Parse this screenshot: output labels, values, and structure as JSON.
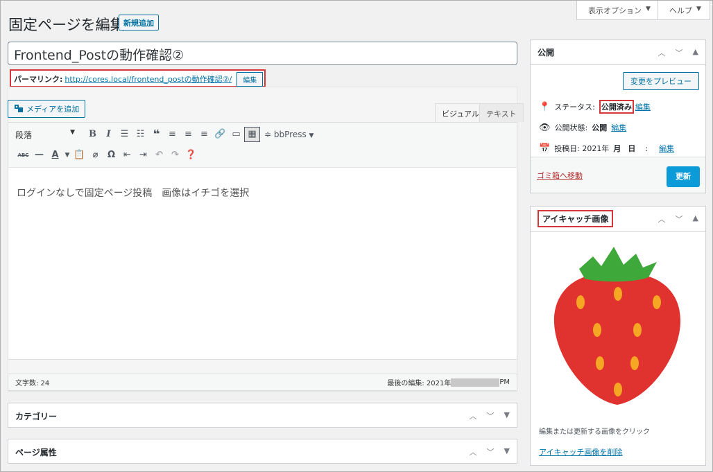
{
  "screen_tabs": {
    "options": "表示オプション",
    "help": "ヘルプ",
    "arrow": "▼"
  },
  "header": {
    "title": "固定ページを編集",
    "add_new": "新規追加"
  },
  "post": {
    "title": "Frontend_Postの動作確認②",
    "permalink_label": "パーマリンク:",
    "permalink_url": "http://cores.local/frontend_postの動作確認②/",
    "permalink_edit": "編集"
  },
  "editor": {
    "media_button": "メディアを追加",
    "tab_visual": "ビジュアル",
    "tab_text": "テキスト",
    "format_select": "段落",
    "bbpress": "bbPress",
    "content": "ログインなしで固定ページ投稿　画像はイチゴを選択",
    "word_count": "文字数: 24",
    "last_edit_prefix": "最後の編集: 2021年",
    "last_edit_suffix": "PM"
  },
  "boxes": {
    "category": "カテゴリー",
    "page_attributes": "ページ属性"
  },
  "publish": {
    "title": "公開",
    "preview": "変更をプレビュー",
    "status_label": "ステータス:",
    "status_value": "公開済み",
    "visibility_label": "公開状態:",
    "visibility_value": "公開",
    "date_label": "投稿日: 2021年",
    "date_month": "月",
    "date_day": "日",
    "date_colon": ":",
    "edit": "編集",
    "trash": "ゴミ箱へ移動",
    "update": "更新"
  },
  "thumbnail": {
    "title": "アイキャッチ画像",
    "hint": "編集または更新する画像をクリック",
    "remove": "アイキャッチ画像を削除"
  },
  "colors": {
    "accent": "#0073aa",
    "highlight": "#d63638",
    "update": "#0a9bd8",
    "strawberry": "#e0322f",
    "leaf": "#3fa83a",
    "seed": "#f5a623"
  },
  "icons": {
    "toolbar_row1": [
      "bold-icon",
      "italic-icon",
      "bullet-list-icon",
      "numbered-list-icon",
      "blockquote-icon",
      "align-left-icon",
      "align-center-icon",
      "align-right-icon",
      "link-icon",
      "read-more-icon",
      "toolbar-toggle-icon"
    ],
    "toolbar_row2": [
      "strikethrough-icon",
      "horizontal-rule-icon",
      "text-color-icon",
      "paste-text-icon",
      "clear-format-icon",
      "special-character-icon",
      "outdent-icon",
      "indent-icon",
      "undo-icon",
      "redo-icon",
      "help-icon"
    ]
  }
}
